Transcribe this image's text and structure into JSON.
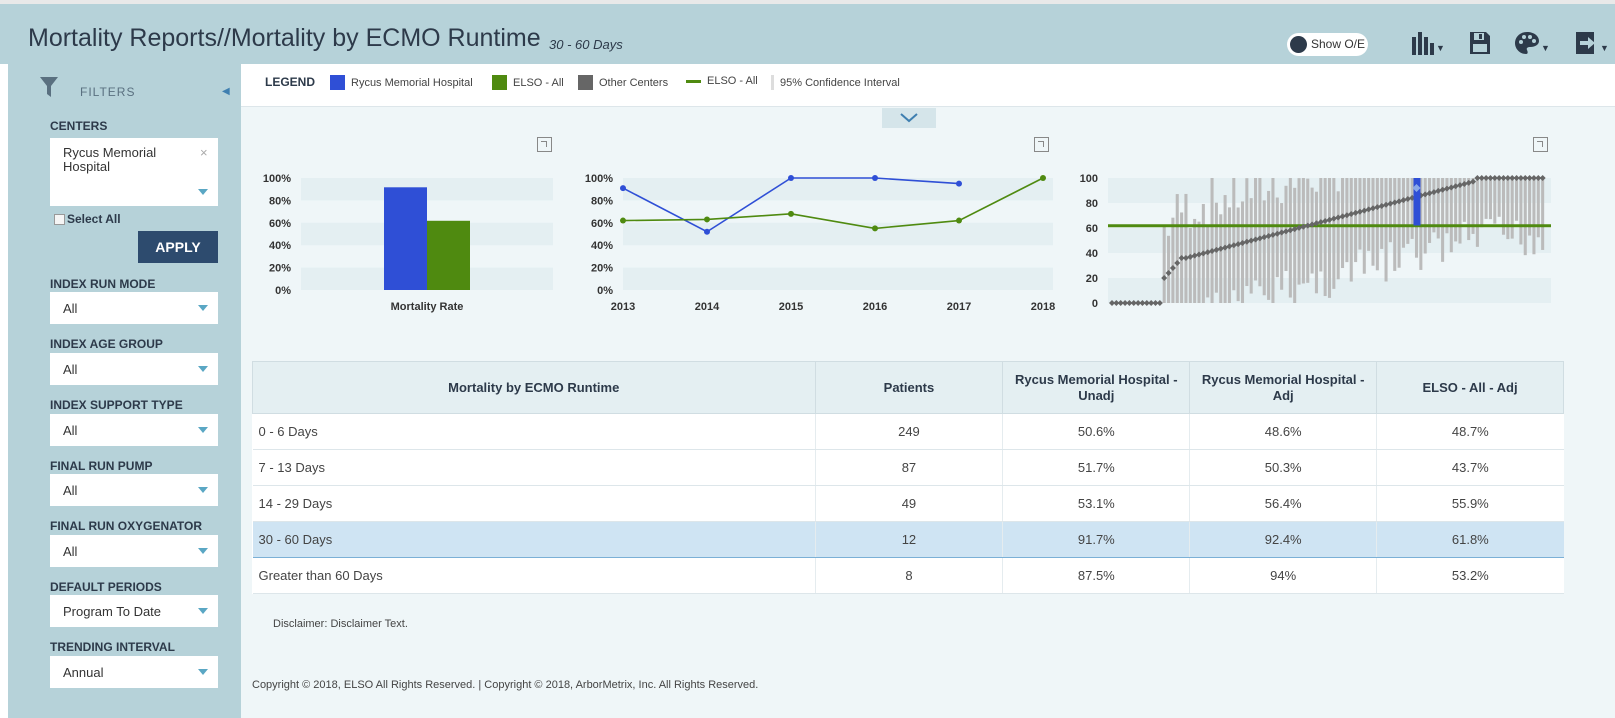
{
  "header": {
    "title": "Mortality Reports//Mortality by ECMO Runtime",
    "subtitle": "30 - 60 Days",
    "toggle_label": "Show O/E",
    "icons": [
      "bar-chart-icon",
      "save-icon",
      "palette-icon",
      "export-icon"
    ]
  },
  "sidebar": {
    "filters_label": "FILTERS",
    "centers_label": "CENTERS",
    "centers_selected": "Rycus Memorial Hospital",
    "select_all_label": "Select All",
    "apply_label": "APPLY",
    "filters": [
      {
        "label": "INDEX RUN MODE",
        "value": "All"
      },
      {
        "label": "INDEX AGE GROUP",
        "value": "All"
      },
      {
        "label": "INDEX SUPPORT TYPE",
        "value": "All"
      },
      {
        "label": "FINAL RUN PUMP",
        "value": "All"
      },
      {
        "label": "FINAL RUN OXYGENATOR",
        "value": "All"
      },
      {
        "label": "DEFAULT PERIODS",
        "value": "Program To Date"
      },
      {
        "label": "TRENDING INTERVAL",
        "value": "Annual"
      }
    ]
  },
  "legend": {
    "title": "LEGEND",
    "items": [
      {
        "label": "Rycus Memorial Hospital",
        "color": "#2f4fd6"
      },
      {
        "label": "ELSO - All",
        "color": "#4f8a10"
      },
      {
        "label": "Other Centers",
        "color": "#666666"
      },
      {
        "label": "ELSO - All",
        "color": "#4f8a10"
      },
      {
        "label": "95% Confidence Interval",
        "color": "#dddddd"
      }
    ]
  },
  "chart_data": [
    {
      "type": "bar",
      "categories": [
        "Mortality Rate"
      ],
      "series": [
        {
          "name": "Rycus Memorial Hospital",
          "values": [
            91.7
          ],
          "color": "#2f4fd6"
        },
        {
          "name": "ELSO - All",
          "values": [
            61.8
          ],
          "color": "#4f8a10"
        }
      ],
      "yticks": [
        "0%",
        "20%",
        "40%",
        "60%",
        "80%",
        "100%"
      ],
      "ylim": [
        0,
        100
      ],
      "xlabel": "Mortality Rate"
    },
    {
      "type": "line",
      "x": [
        "2013",
        "2014",
        "2015",
        "2016",
        "2017",
        "2018"
      ],
      "series": [
        {
          "name": "Rycus Memorial Hospital",
          "values": [
            91,
            52,
            100,
            100,
            95,
            null
          ],
          "color": "#2f4fd6"
        },
        {
          "name": "ELSO - All",
          "values": [
            62,
            63,
            68,
            55,
            62,
            100
          ],
          "color": "#4f8a10"
        }
      ],
      "yticks": [
        "0%",
        "20%",
        "40%",
        "60%",
        "80%",
        "100%"
      ],
      "ylim": [
        0,
        100
      ]
    },
    {
      "type": "scatter",
      "yticks": [
        "0",
        "20",
        "40",
        "60",
        "80",
        "100"
      ],
      "ylim": [
        0,
        100
      ],
      "reference_line": 61.8,
      "highlight_index": 70,
      "highlight_value": 92,
      "n_centers": 100,
      "series_color": "#666666",
      "ci_color": "#bbbbbb",
      "reference_color": "#4f8a10",
      "highlight_color": "#2f4fd6"
    }
  ],
  "table": {
    "headers": [
      "Mortality by ECMO Runtime",
      "Patients",
      "Rycus Memorial Hospital - Unadj",
      "Rycus Memorial Hospital - Adj",
      "ELSO - All - Adj"
    ],
    "rows": [
      [
        "0 - 6 Days",
        "249",
        "50.6%",
        "48.6%",
        "48.7%"
      ],
      [
        "7 - 13 Days",
        "87",
        "51.7%",
        "50.3%",
        "43.7%"
      ],
      [
        "14 - 29 Days",
        "49",
        "53.1%",
        "56.4%",
        "55.9%"
      ],
      [
        "30 - 60 Days",
        "12",
        "91.7%",
        "92.4%",
        "61.8%"
      ],
      [
        "Greater than 60 Days",
        "8",
        "87.5%",
        "94%",
        "53.2%"
      ]
    ],
    "selected_row": 3
  },
  "disclaimer": "Disclaimer: Disclaimer Text.",
  "copyright": "Copyright © 2018, ELSO All Rights Reserved. | Copyright © 2018, ArborMetrix, Inc. All Rights Reserved."
}
